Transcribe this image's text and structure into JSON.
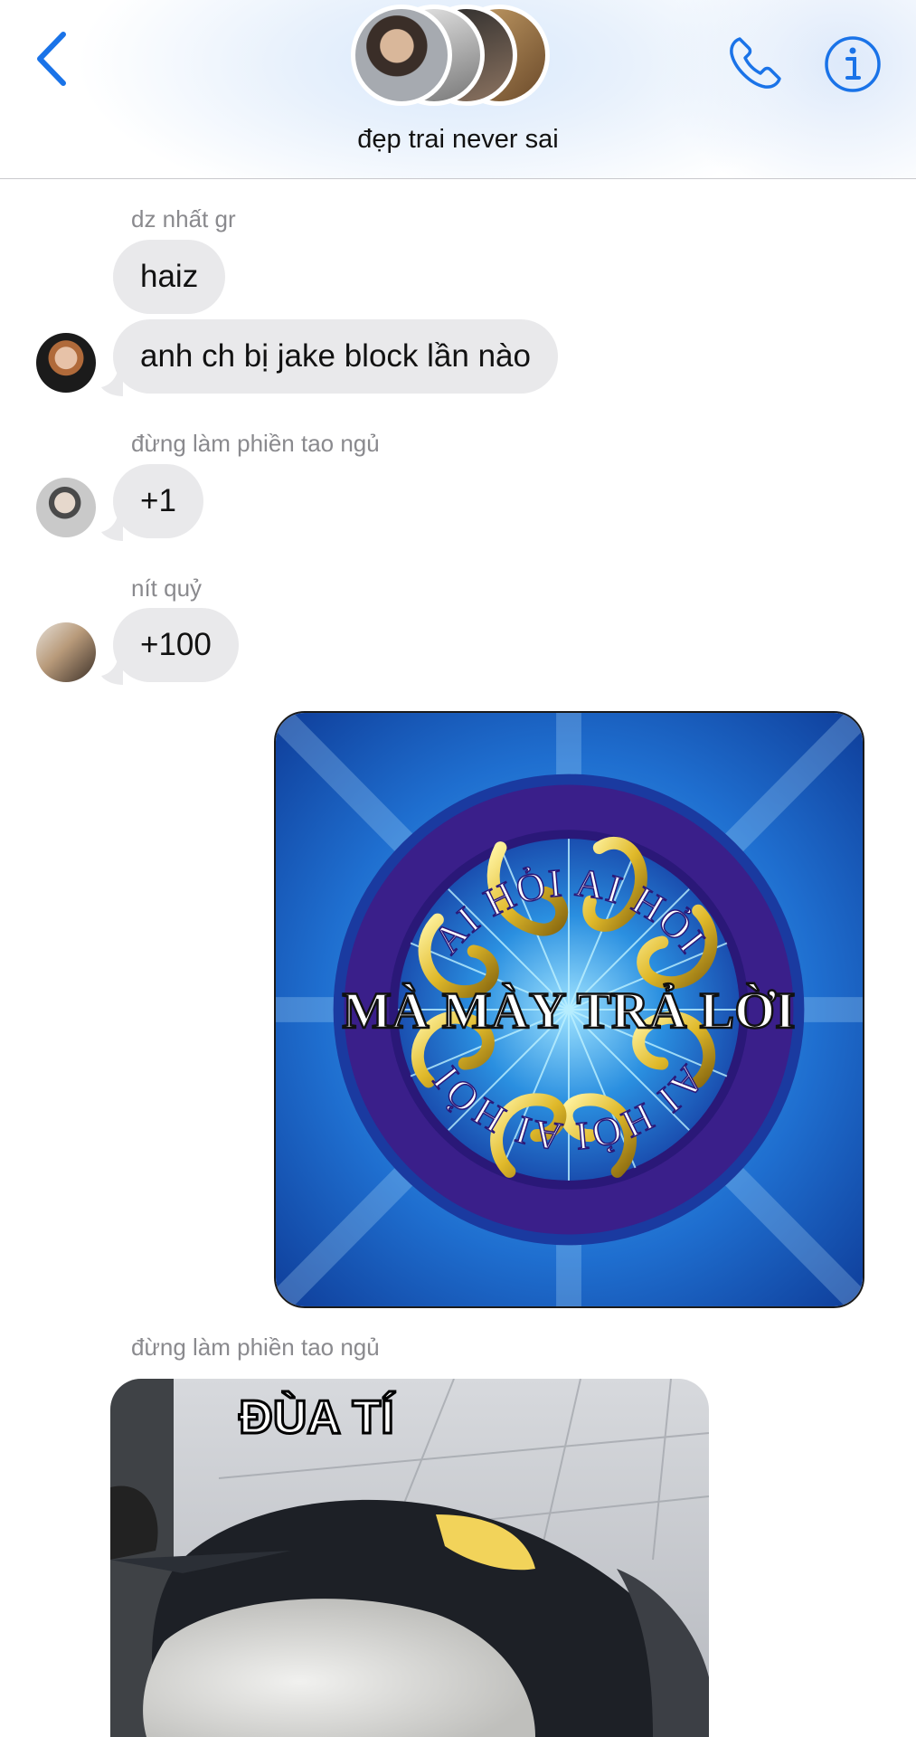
{
  "header": {
    "title": "đẹp trai never sai",
    "back_icon": "chevron-left-icon",
    "call_icon": "phone-icon",
    "info_icon": "info-icon",
    "accent_color": "#1a73e8"
  },
  "messages": [
    {
      "sender": "dz nhất gr",
      "texts": [
        "haiz",
        "anh ch bị jake block lần nào"
      ]
    },
    {
      "sender": "đừng làm phiền tao ngủ",
      "texts": [
        "+1"
      ]
    },
    {
      "sender": "nít quỷ",
      "texts": [
        "+100"
      ]
    }
  ],
  "meme1": {
    "top_text": "AI HỎI AI HỎI",
    "center_text": "MÀ MÀY TRẢ LỜI",
    "bottom_text": "AI HỎI AI HỎI"
  },
  "message4": {
    "sender": "đừng làm phiền tao ngủ",
    "meme_caption": "ĐÙA TÍ"
  },
  "colors": {
    "bubble_bg": "#e9e9eb",
    "sender_text": "#8a8a8e"
  }
}
